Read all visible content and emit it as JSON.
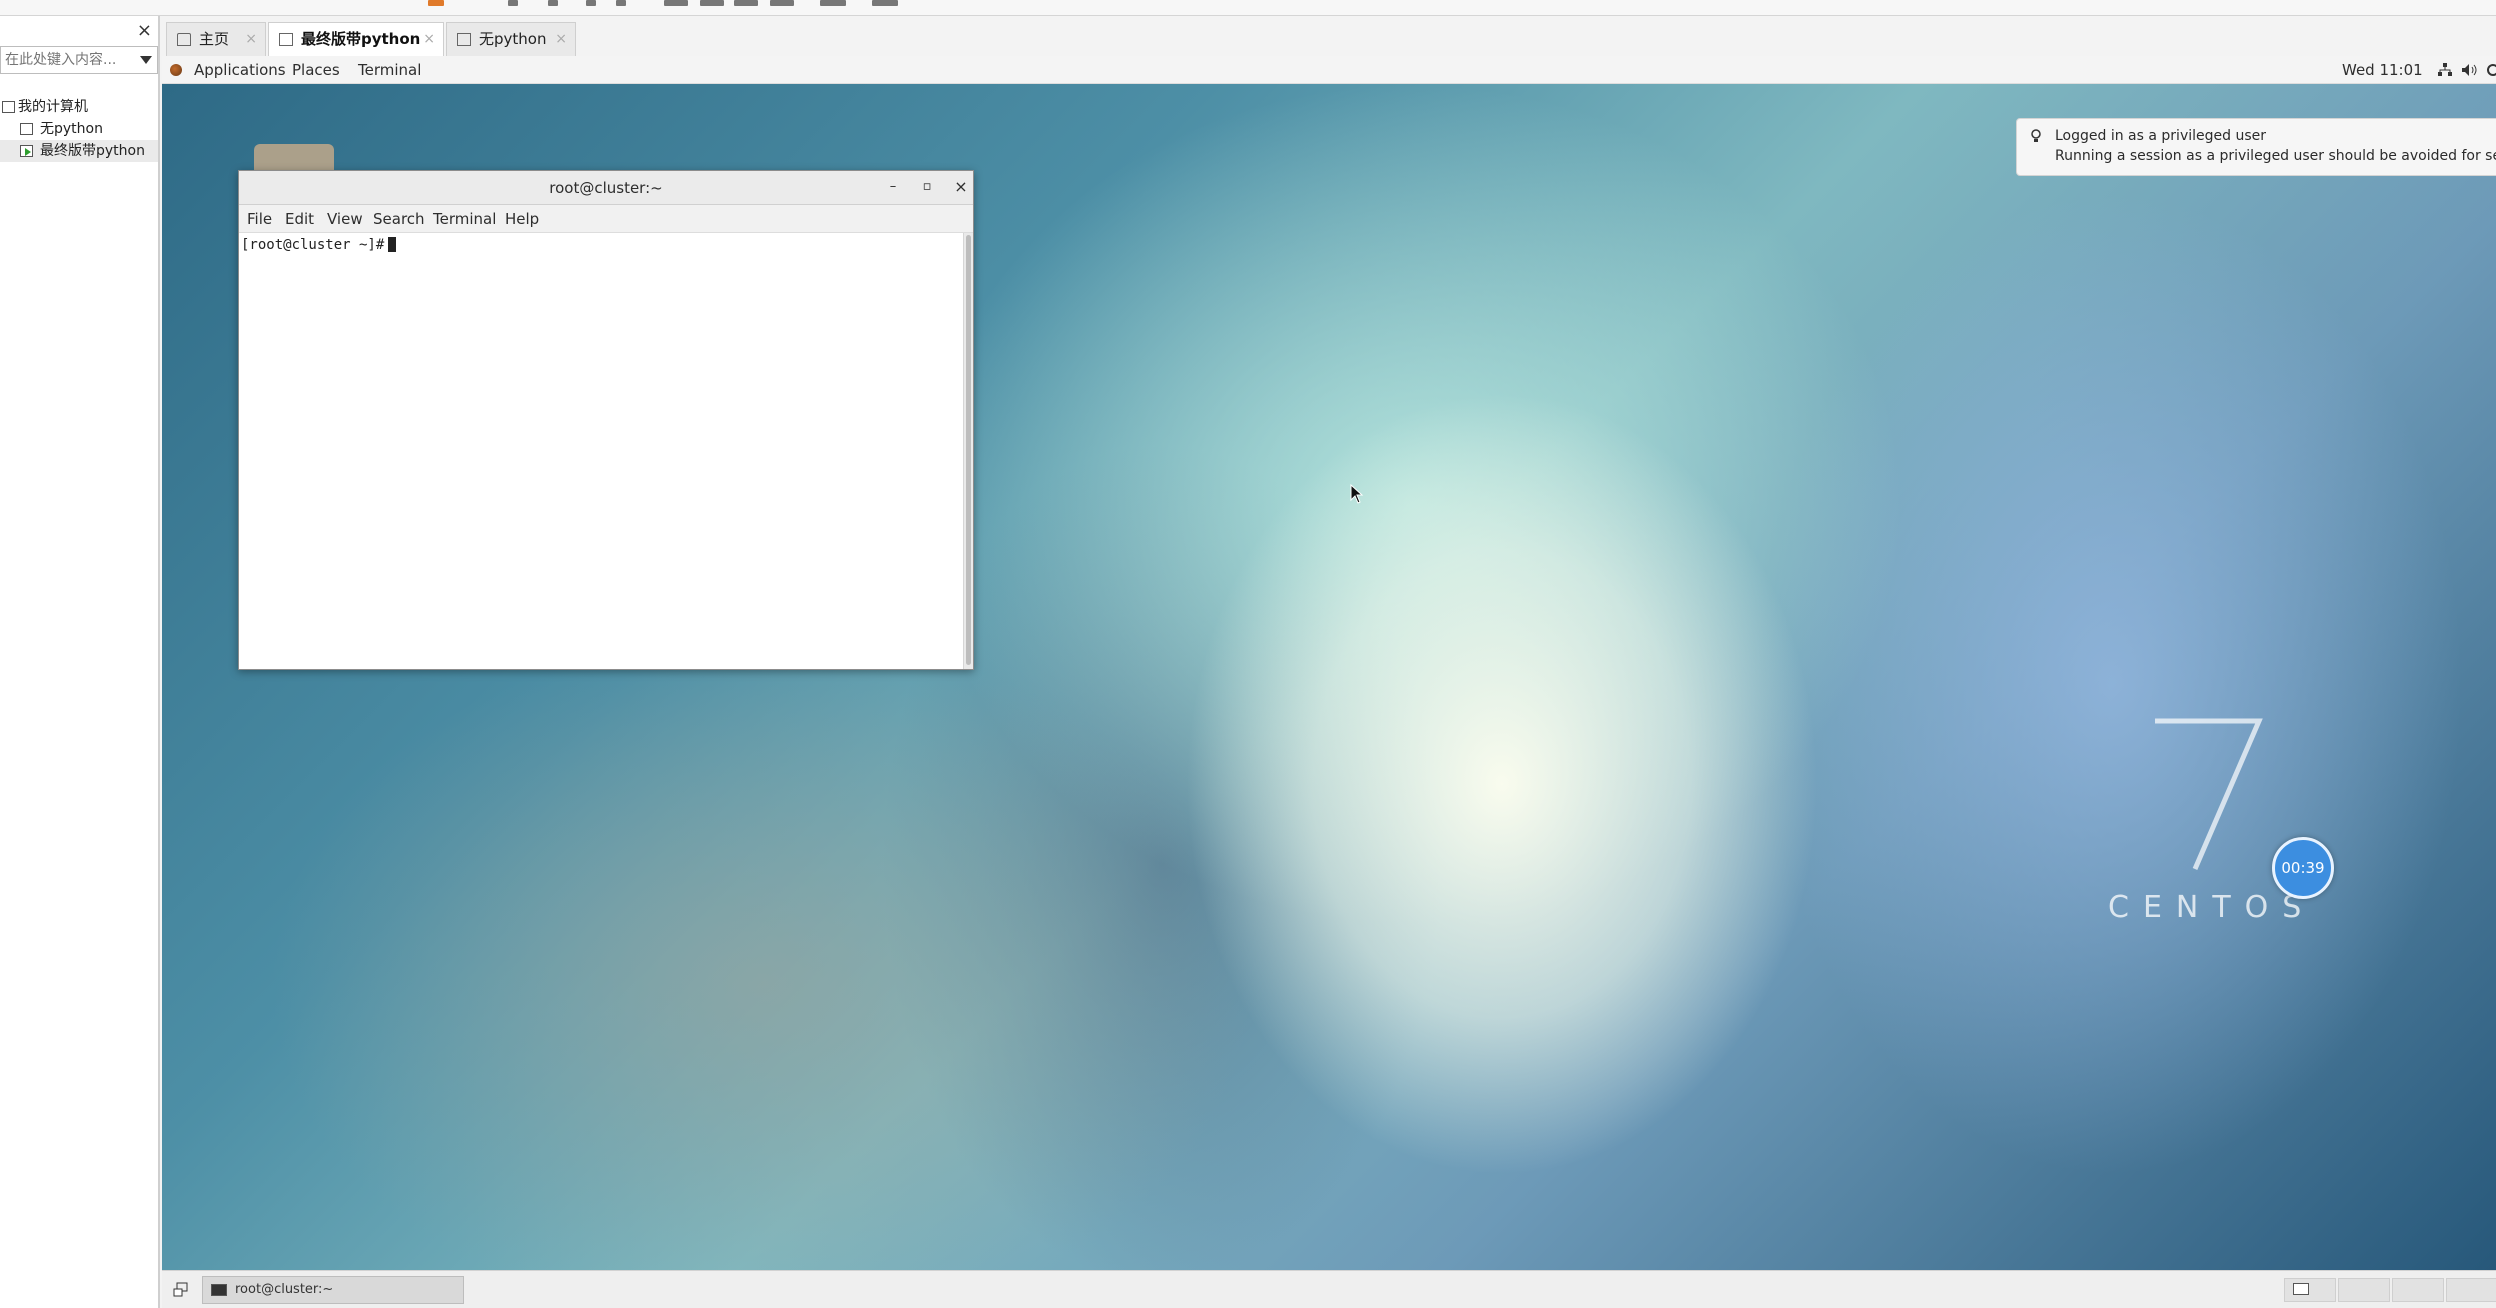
{
  "library": {
    "search_placeholder": "在此处键入内容...",
    "close_glyph": "×",
    "tree": [
      {
        "label": "我的计算机"
      },
      {
        "label": "无python"
      },
      {
        "label": "最终版带python"
      }
    ]
  },
  "tabs": [
    {
      "label": "主页",
      "close": "×"
    },
    {
      "label": "最终版带python",
      "close": "×"
    },
    {
      "label": "无python",
      "close": "×"
    }
  ],
  "gnome": {
    "applications": "Applications",
    "places": "Places",
    "terminal": "Terminal",
    "clock": "Wed 11:01"
  },
  "notification": {
    "title": "Logged in as a privileged user",
    "body": "Running a session as a privileged user should be avoided for security."
  },
  "terminal": {
    "title": "root@cluster:~",
    "menu": [
      "File",
      "Edit",
      "View",
      "Search",
      "Terminal",
      "Help"
    ],
    "prompt": "[root@cluster ~]#",
    "min_glyph": "–",
    "max_glyph": "▫",
    "close_glyph": "×"
  },
  "desktop": {
    "centos_number": "7",
    "centos_text": "CENTOS",
    "timer": "00:39"
  },
  "taskbar": {
    "task_label": "root@cluster:~"
  }
}
